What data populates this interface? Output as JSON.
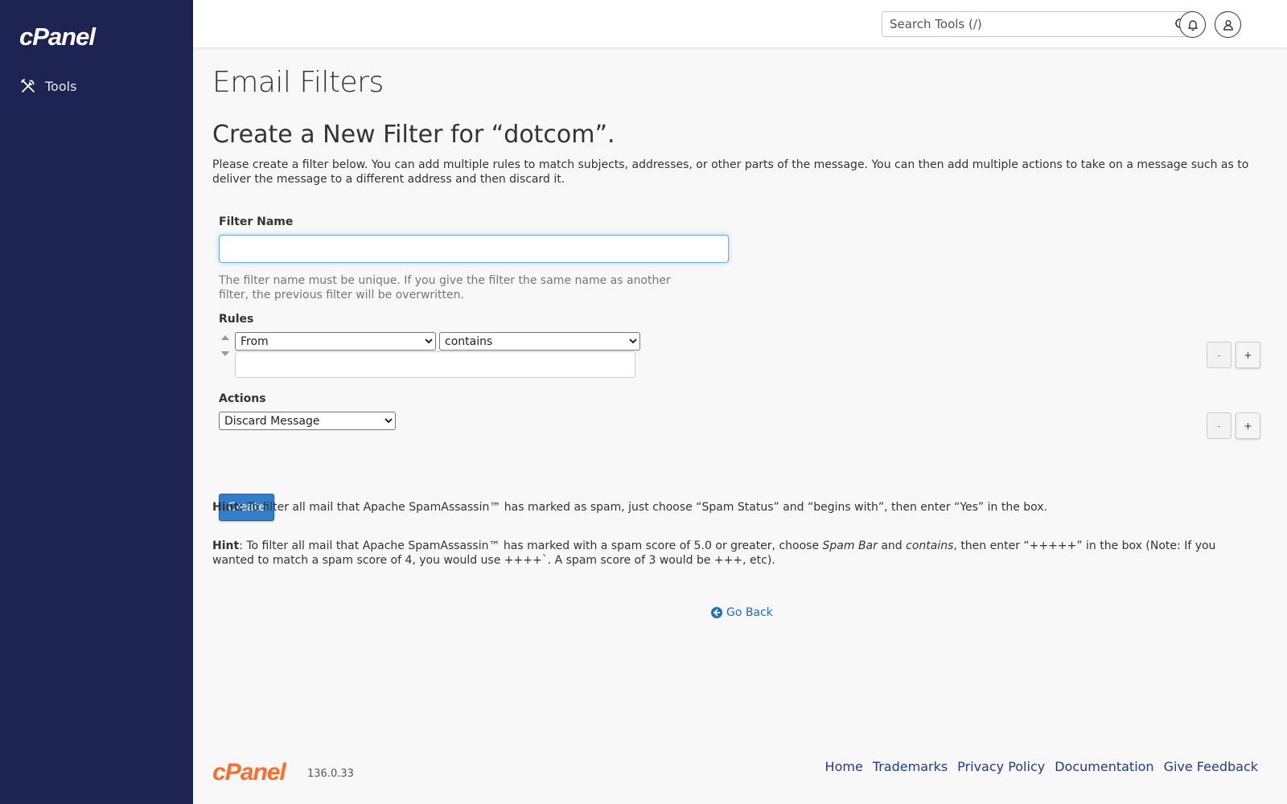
{
  "sidebar": {
    "logo": "cPanel",
    "items": [
      {
        "label": "Tools",
        "icon": "tools-icon"
      }
    ]
  },
  "topbar": {
    "search_placeholder": "Search Tools (/)",
    "icons": [
      "search-icon",
      "bell-icon",
      "user-icon"
    ]
  },
  "page": {
    "title": "Email Filters",
    "section_title": "Create a New Filter for “dotcom”.",
    "intro": "Please create a filter below. You can add multiple rules to match subjects, addresses, or other parts of the message. You can then add multiple actions to take on a message such as to deliver the message to a different address and then discard it."
  },
  "form": {
    "filter_name_label": "Filter Name",
    "filter_name_value": "",
    "filter_name_help": "The filter name must be unique. If you give the filter the same name as another filter, the previous filter will be overwritten.",
    "rules_label": "Rules",
    "rule_field_selected": "From",
    "rule_operator_selected": "contains",
    "rule_value": "",
    "actions_label": "Actions",
    "action_selected": "Discard Message",
    "minus_label": "-",
    "plus_label": "+",
    "create_label": "Create"
  },
  "hints": {
    "hint_prefix_1": "Hint:",
    "hint_text_1": " To filter all mail that Apache SpamAssassin™ has marked as spam, just choose “Spam Status” and “begins with”, then enter “Yes” in the box.",
    "hint_prefix_2": "Hint",
    "hint_text_2a": ": To filter all mail that Apache SpamAssassin™ has marked with a spam score of 5.0 or greater, choose ",
    "hint_em_1": "Spam Bar",
    "hint_text_2b": " and ",
    "hint_em_2": "contains",
    "hint_text_2c": ", then enter “+++++” in the box (Note: If you wanted to match a spam score of 4, you would use ++++`. A spam score of 3 would be +++, etc)."
  },
  "go_back_label": "Go Back",
  "footer": {
    "logo": "cPanel",
    "version": "136.0.33",
    "links": [
      "Home",
      "Trademarks",
      "Privacy Policy",
      "Documentation",
      "Give Feedback"
    ]
  },
  "colors": {
    "sidebar_bg": "#1e2452",
    "primary_button": "#337ec8",
    "link": "#1e6fb8",
    "footer_link": "#1e3d8f",
    "brand_orange": "#ff6c2c"
  }
}
